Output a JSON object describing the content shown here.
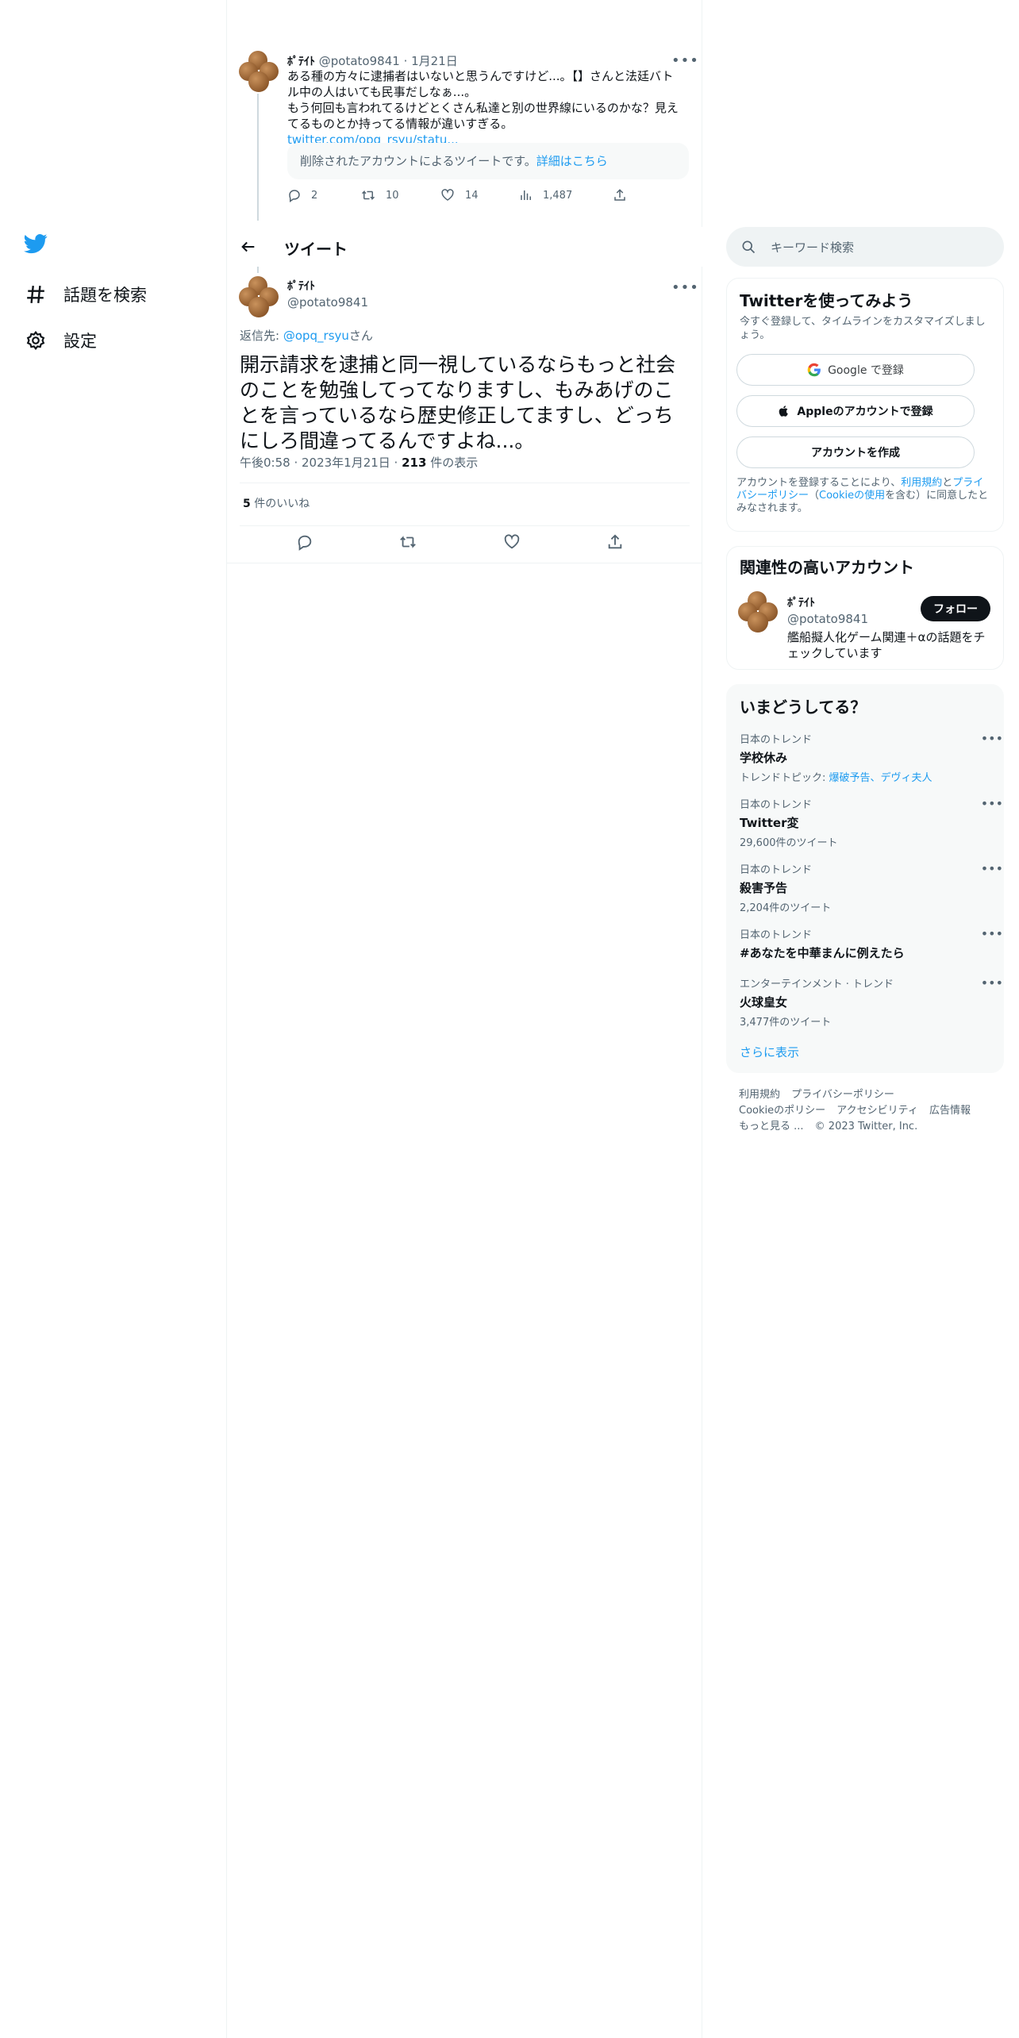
{
  "nav": {
    "items": [
      {
        "label": "話題を検索"
      },
      {
        "label": "設定"
      }
    ]
  },
  "prev_tweet": {
    "name": "ﾎﾟﾃｲﾄ",
    "handle": "@potato9841",
    "sep": "·",
    "date": "1月21日",
    "line1": "ある種の方々に逮捕者はいないと思うんですけど...。【】さんと法廷バト",
    "line2": "ル中の人はいても民事だしなぁ...。",
    "line3": "もう何回も言われてるけどとくさん私達と別の世界線にいるのかな？見え",
    "line4": "てるものとか持ってる情報が違いすぎる。",
    "link": "twitter.com/opq_rsyu/statu...",
    "deleted_text": "削除されたアカウントによるツイートです。",
    "deleted_link": "詳細はこちら",
    "replies": "2",
    "retweets": "10",
    "likes": "14",
    "views": "1,487"
  },
  "header": {
    "title": "ツイート"
  },
  "main_tweet": {
    "name": "ﾎﾟﾃｲﾄ",
    "handle": "@potato9841",
    "reply_prefix": "返信先: ",
    "reply_handle": "@opq_rsyu",
    "reply_suffix": "さん",
    "text": "開示請求を逮捕と同一視しているならもっと社会のことを勉強してってなりますし、もみあげのことを言っているなら歴史修正してますし、どっちにしろ間違ってるんですよね...。",
    "time": "午後0:58 · 2023年1月21日 · ",
    "views_count": "213",
    "views_label": " 件の表示",
    "likes_count": "5",
    "likes_label": " 件のいいね"
  },
  "search": {
    "placeholder": "キーワード検索"
  },
  "signup": {
    "title": "Twitterを使ってみよう",
    "subtitle": "今すぐ登録して、タイムラインをカスタマイズしましょう。",
    "google": "Google で登録",
    "apple": "Appleのアカウントで登録",
    "create": "アカウントを作成",
    "legal_1": "アカウントを登録することにより、",
    "legal_link1": "利用規約",
    "legal_2": "と",
    "legal_link2": "プライバシーポリシー",
    "legal_3": "（",
    "legal_link3": "Cookieの使用",
    "legal_4": "を含む）に同意したとみなされます。"
  },
  "related": {
    "title": "関連性の高いアカウント",
    "name": "ﾎﾟﾃｲﾄ",
    "handle": "@potato9841",
    "bio": "艦船擬人化ゲーム関連＋αの話題をチェックしています",
    "follow": "フォロー"
  },
  "trends": {
    "title": "いまどうしてる？",
    "items": [
      {
        "category": "日本のトレンド",
        "name": "学校休み",
        "count_prefix": "トレンドトピック: ",
        "links": "爆破予告、デヴィ夫人"
      },
      {
        "category": "日本のトレンド",
        "name": "Twitter変",
        "count": "29,600件のツイート"
      },
      {
        "category": "日本のトレンド",
        "name": "殺害予告",
        "count": "2,204件のツイート"
      },
      {
        "category": "日本のトレンド",
        "name": "#あなたを中華まんに例えたら",
        "count": ""
      },
      {
        "category": "エンターテインメント · トレンド",
        "name": "火球皇女",
        "count": "3,477件のツイート"
      }
    ],
    "more": "さらに表示"
  },
  "footer": {
    "terms": "利用規約",
    "privacy": "プライバシーポリシー",
    "cookie": "Cookieのポリシー",
    "accessibility": "アクセシビリティ",
    "ads": "広告情報",
    "more": "もっと見る ...",
    "copyright": "© 2023 Twitter, Inc."
  },
  "colors": {
    "accent": "#1d9bf0",
    "text": "#0f1419",
    "secondary": "#536471"
  }
}
